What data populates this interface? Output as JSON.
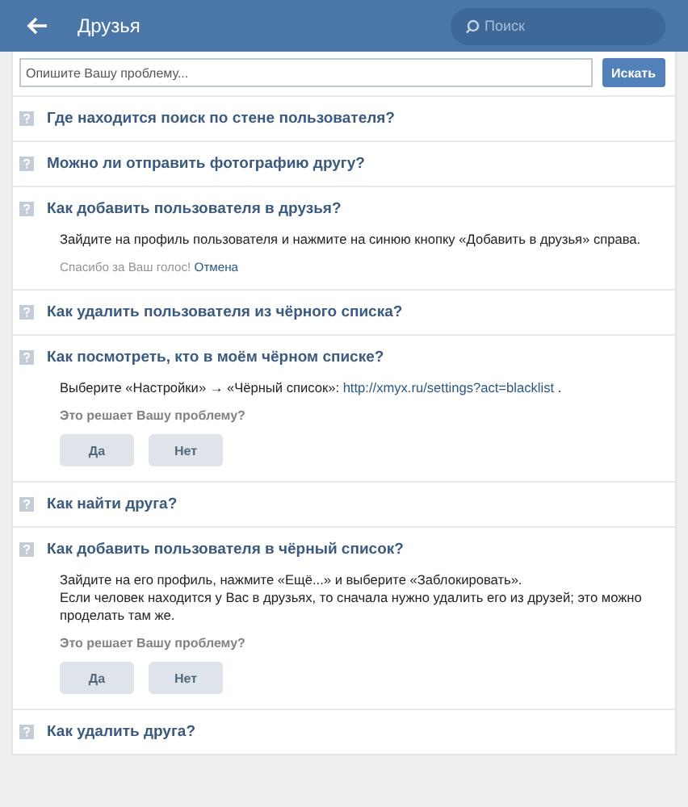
{
  "header": {
    "title": "Друзья",
    "search_placeholder": "Поиск"
  },
  "help_search": {
    "placeholder": "Опишите Вашу проблему...",
    "button": "Искать"
  },
  "questions": [
    {
      "question": "Где находится поиск по стене пользователя?"
    },
    {
      "question": "Можно ли отправить фотографию другу?"
    },
    {
      "question": "Как добавить пользователя в друзья?",
      "answer": [
        [
          {
            "kind": "text",
            "text": "Зайдите на профиль пользователя и нажмите на синюю кнопку «Добавить в друзья» справа."
          }
        ]
      ],
      "feedback": {
        "kind": "thanks",
        "text": "Спасибо за Ваш голос!",
        "cancel": "Отмена"
      }
    },
    {
      "question": "Как удалить пользователя из чёрного списка?"
    },
    {
      "question": "Как посмотреть, кто в моём чёрном списке?",
      "answer": [
        [
          {
            "kind": "text",
            "text": "Выберите «Настройки» → «Чёрный список»: "
          },
          {
            "kind": "link",
            "text": "http://xmyx.ru/settings?act=blacklist"
          },
          {
            "kind": "text",
            "text": " ."
          }
        ]
      ],
      "feedback": {
        "kind": "vote",
        "prompt": "Это решает Вашу проблему?",
        "yes": "Да",
        "no": "Нет"
      }
    },
    {
      "question": "Как найти друга?"
    },
    {
      "question": "Как добавить пользователя в чёрный список?",
      "answer": [
        [
          {
            "kind": "text",
            "text": "Зайдите на его профиль, нажмите «Ещё...» и выберите «Заблокировать»."
          }
        ],
        [
          {
            "kind": "text",
            "text": "Если человек находится у Вас в друзьях, то сначала нужно удалить его из друзей; это можно проделать там же."
          }
        ]
      ],
      "feedback": {
        "kind": "vote",
        "prompt": "Это решает Вашу проблему?",
        "yes": "Да",
        "no": "Нет"
      }
    },
    {
      "question": "Как удалить друга?"
    }
  ]
}
